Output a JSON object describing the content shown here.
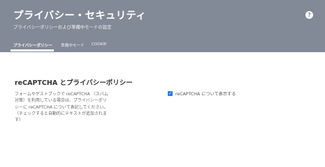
{
  "header": {
    "title": "プライバシー・セキュリティ",
    "subtitle": "プライバシーポリシーおよび準備中モードの設定",
    "help_label": "?"
  },
  "tabs": [
    {
      "label": "プライバシーポリシー",
      "active": true
    },
    {
      "label": "準備中モード",
      "active": false
    },
    {
      "label": "COOKIE",
      "active": false
    }
  ],
  "section": {
    "title": "reCAPTCHA とプライバシーポリシー",
    "description": "フォームやゲストブックで reCAPTCHA （スパム対策）を利用している場合は、プライバシーポリシーに reCAPTCHA について表記してください。（チェックすると自動的にテキストが追加されます）"
  },
  "checkbox": {
    "label": "reCAPTCHA について表示する",
    "checked": true,
    "check_glyph": "✓"
  },
  "colors": {
    "header_bg": "#828a97",
    "checkbox_accent": "#2e7bd4"
  }
}
